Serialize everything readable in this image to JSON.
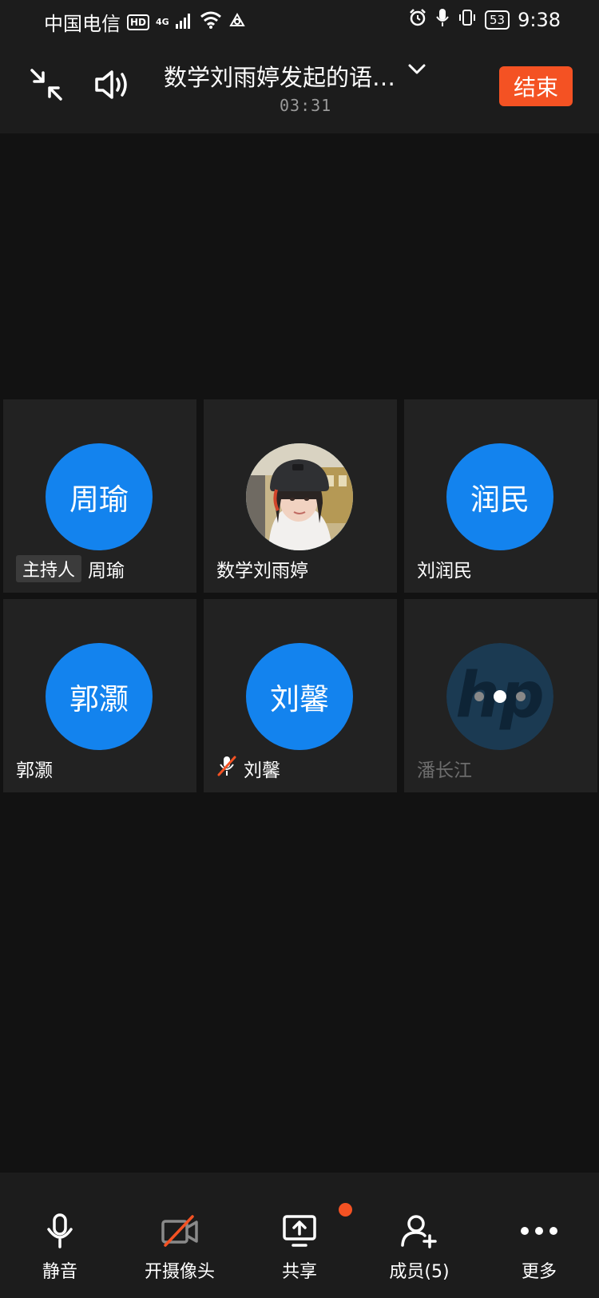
{
  "status_bar": {
    "carrier": "中国电信",
    "hd": "HD",
    "network": "4G",
    "battery": "53",
    "time": "9:38"
  },
  "header": {
    "title": "数学刘雨婷发起的语…",
    "timer": "03:31",
    "end_label": "结束"
  },
  "participants": [
    {
      "avatar_text": "周瑜",
      "name": "周瑜",
      "tag": "主持人"
    },
    {
      "avatar_text": "",
      "name": "数学刘雨婷"
    },
    {
      "avatar_text": "润民",
      "name": "刘润民"
    },
    {
      "avatar_text": "郭灏",
      "name": "郭灏"
    },
    {
      "avatar_text": "刘馨",
      "name": "刘馨",
      "muted": true
    },
    {
      "avatar_text": "hp",
      "name": "潘长江",
      "state": "connecting"
    }
  ],
  "toolbar": {
    "mute_label": "静音",
    "camera_label": "开摄像头",
    "share_label": "共享",
    "members_label": "成员(5)",
    "more_label": "更多"
  },
  "colors": {
    "accent": "#1383ee",
    "end": "#f45223",
    "background": "#121212",
    "tile": "#222222"
  }
}
